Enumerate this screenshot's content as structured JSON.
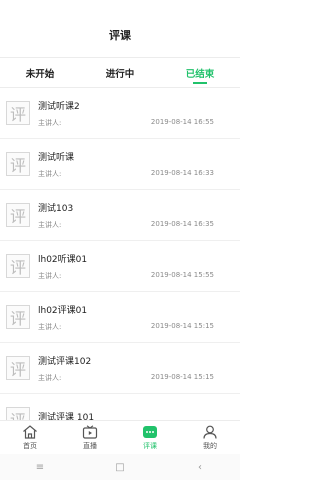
{
  "header": {
    "title": "评课"
  },
  "tabs": [
    {
      "label": "未开始"
    },
    {
      "label": "进行中"
    },
    {
      "label": "已结束"
    }
  ],
  "list": {
    "thumb_char": "评",
    "items": [
      {
        "title": "测试听课2",
        "teacher_label": "主讲人:",
        "date": "2019-08-14 16:55"
      },
      {
        "title": "测试听课",
        "teacher_label": "主讲人:",
        "date": "2019-08-14 16:33"
      },
      {
        "title": "测试103",
        "teacher_label": "主讲人:",
        "date": "2019-08-14 16:35"
      },
      {
        "title": "lh02听课01",
        "teacher_label": "主讲人:",
        "date": "2019-08-14 15:55"
      },
      {
        "title": "lh02评课01",
        "teacher_label": "主讲人:",
        "date": "2019-08-14 15:15"
      },
      {
        "title": "测试评课102",
        "teacher_label": "主讲人:",
        "date": "2019-08-14 15:15"
      },
      {
        "title": "测试评课 101",
        "teacher_label": "",
        "date": ""
      }
    ]
  },
  "bottom_nav": [
    {
      "label": "首页"
    },
    {
      "label": "直播"
    },
    {
      "label": "评课"
    },
    {
      "label": "我的"
    }
  ],
  "system_nav": {
    "menu": "≡",
    "home": "□",
    "back": "‹"
  },
  "colors": {
    "accent": "#21c26b"
  }
}
